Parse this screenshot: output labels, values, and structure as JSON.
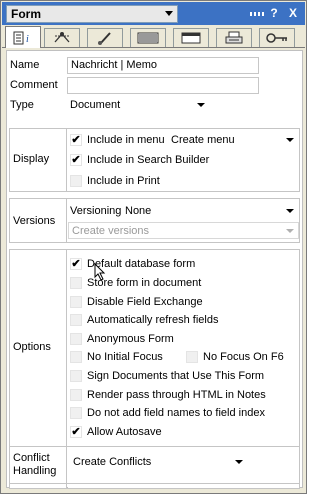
{
  "titlebar": {
    "selector_label": "Form",
    "help_label": "?",
    "close_label": "X"
  },
  "tabs": [
    {
      "icon": "info-icon"
    },
    {
      "icon": "fields-icon"
    },
    {
      "icon": "paint-brush-icon"
    },
    {
      "icon": "background-icon"
    },
    {
      "icon": "header-icon"
    },
    {
      "icon": "printer-icon"
    },
    {
      "icon": "key-icon"
    }
  ],
  "basics": {
    "name_label": "Name",
    "name_value": "Nachricht | Memo",
    "comment_label": "Comment",
    "comment_value": "",
    "type_label": "Type",
    "type_value": "Document"
  },
  "display": {
    "label": "Display",
    "include_in_menu": {
      "label": "Include in menu",
      "checked": true
    },
    "menu_option": "Create menu",
    "include_in_search_builder": {
      "label": "Include in Search Builder",
      "checked": true
    },
    "include_in_print": {
      "label": "Include in Print",
      "checked": false
    }
  },
  "versions": {
    "label": "Versions",
    "versioning_label": "Versioning",
    "versioning_value": "None",
    "create_versions_value": "Create versions"
  },
  "options": {
    "label": "Options",
    "items": [
      {
        "label": "Default database form",
        "checked": true
      },
      {
        "label": "Store form in document",
        "checked": false
      },
      {
        "label": "Disable Field Exchange",
        "checked": false
      },
      {
        "label": "Automatically refresh fields",
        "checked": false
      },
      {
        "label": "Anonymous Form",
        "checked": false
      },
      {
        "label": "No Initial Focus",
        "checked": false
      },
      {
        "label": "No Focus On F6",
        "checked": false
      },
      {
        "label": "Sign Documents that Use This Form",
        "checked": false
      },
      {
        "label": "Render pass through HTML in Notes",
        "checked": false
      },
      {
        "label": "Do not add field names to field index",
        "checked": false
      },
      {
        "label": "Allow Autosave",
        "checked": true
      }
    ]
  },
  "conflict": {
    "label_line1": "Conflict",
    "label_line2": "Handling",
    "value": "Create Conflicts"
  },
  "checkmark": "✔"
}
